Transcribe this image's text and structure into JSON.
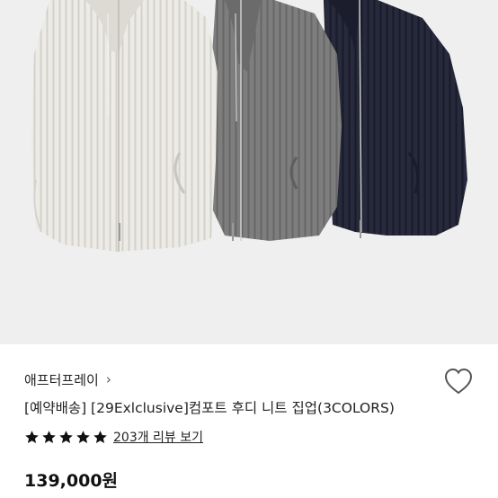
{
  "product": {
    "brand_label": "애프터프레이",
    "brand_chevron": "›",
    "title": "[예약배송] [29Exlclusive]컴포트 후디 니트 집업(3COLORS)",
    "rating": 5,
    "review_link": "203개 리뷰 보기",
    "price": "139,000원"
  },
  "icons": {
    "heart": "heart-outline-icon",
    "star": "star-filled-icon"
  },
  "colors": {
    "hero_bg": "#efefef",
    "knit_ivory": "#ecebe6",
    "knit_gray": "#7c7c7c",
    "knit_navy": "#25273a",
    "star": "#111111"
  }
}
